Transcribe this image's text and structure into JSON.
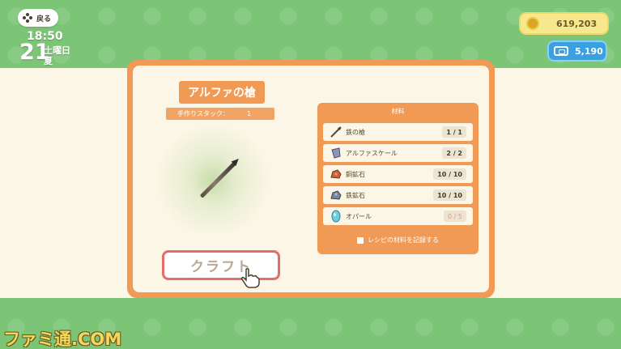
{
  "hud": {
    "back_label": "戻る",
    "time": "18:50",
    "date": "21",
    "weekday": "土曜日",
    "season": "夏",
    "bells": "619,203",
    "miles": "5,190"
  },
  "recipe": {
    "item_name": "アルファの槍",
    "stack_label": "手作りスタック：",
    "stack_value": "1",
    "craft_label": "クラフト"
  },
  "materials": {
    "header": "材料",
    "items": [
      {
        "name": "鉄の槍",
        "count": "1 / 1",
        "icon": "spear-icon"
      },
      {
        "name": "アルファスケール",
        "count": "2 / 2",
        "icon": "scale-icon"
      },
      {
        "name": "銅鉱石",
        "count": "10 / 10",
        "icon": "copper-ore-icon"
      },
      {
        "name": "鉄鉱石",
        "count": "10 / 10",
        "icon": "iron-ore-icon"
      },
      {
        "name": "オパール",
        "count": "0 / 5",
        "icon": "opal-icon"
      }
    ],
    "record_label": "レシピの材料を記録する"
  },
  "watermark": "ファミ通.COM"
}
